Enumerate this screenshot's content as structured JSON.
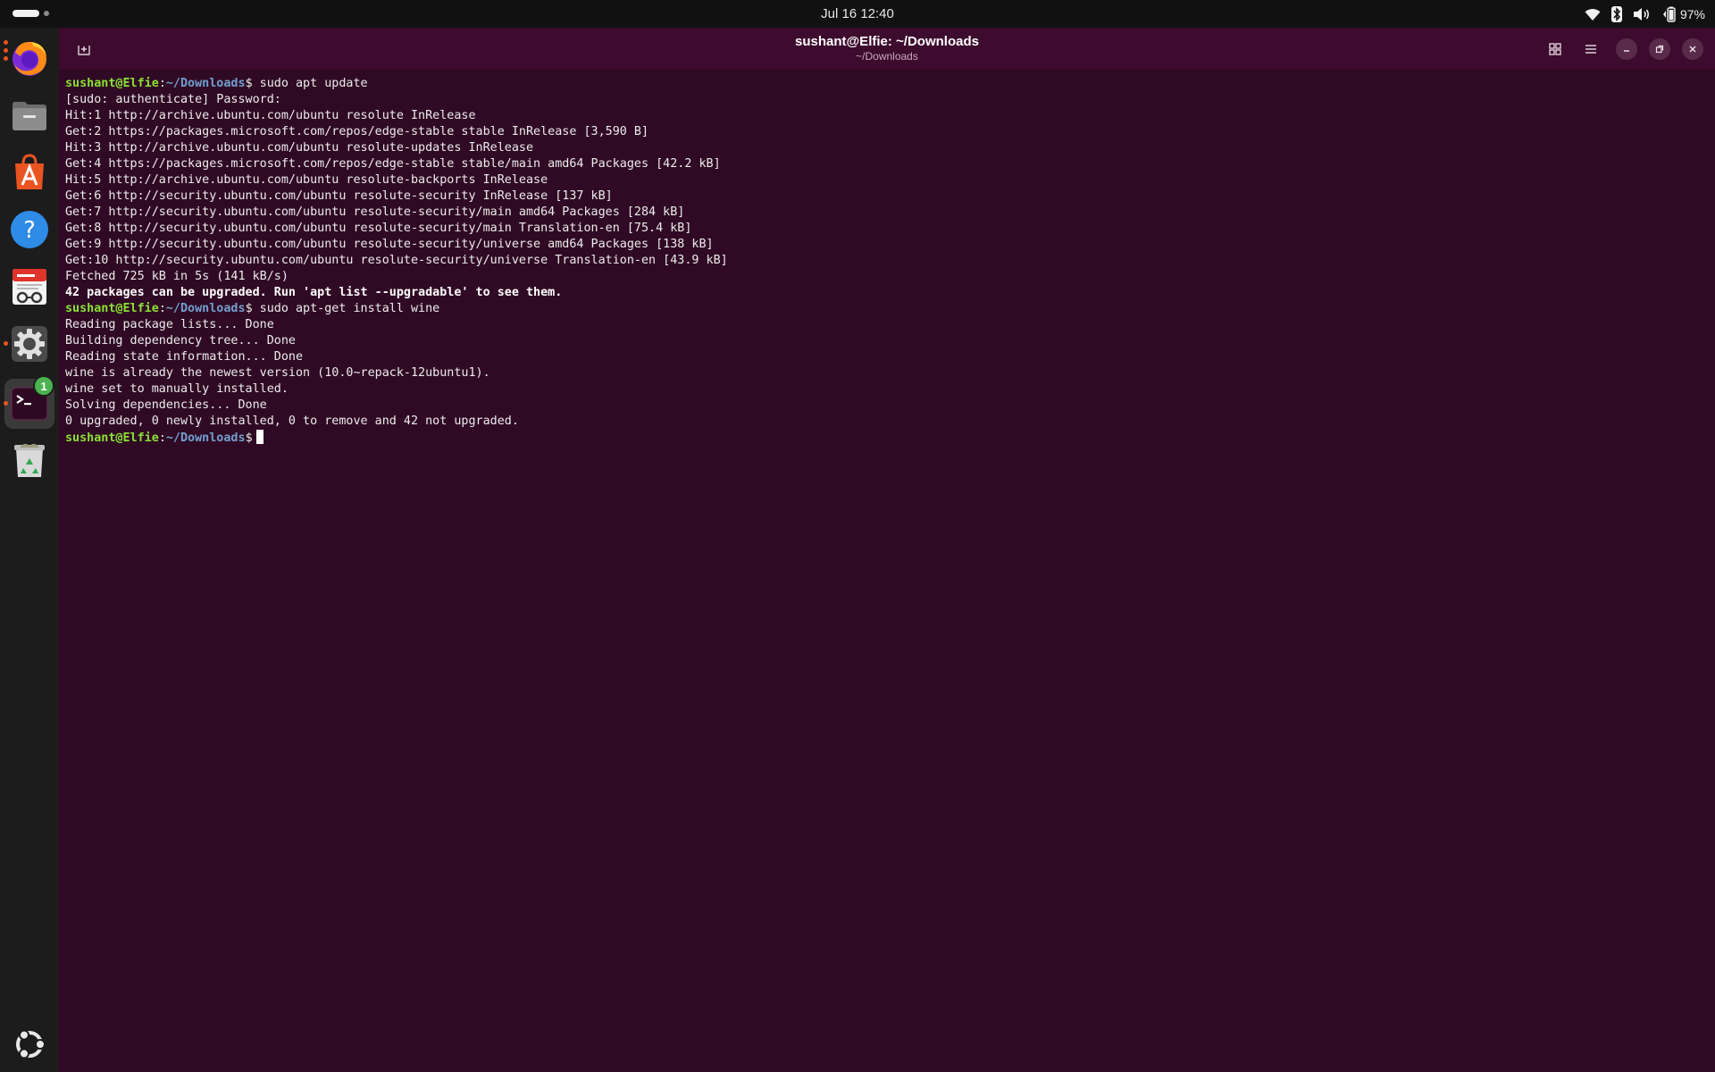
{
  "topbar": {
    "clock": "Jul 16  12:40",
    "battery": "97%"
  },
  "dock": {
    "apps": [
      {
        "name": "firefox",
        "icon": "firefox-icon"
      },
      {
        "name": "files",
        "icon": "files-icon"
      },
      {
        "name": "app-center",
        "icon": "app-center-icon"
      },
      {
        "name": "help",
        "icon": "help-icon"
      },
      {
        "name": "document-viewer",
        "icon": "document-viewer-icon"
      },
      {
        "name": "settings",
        "icon": "gear-icon"
      },
      {
        "name": "terminal",
        "icon": "terminal-icon",
        "badge": "1"
      },
      {
        "name": "trash",
        "icon": "trash-icon"
      }
    ],
    "show_apps_icon": "ubuntu-logo-icon"
  },
  "window": {
    "title": "sushant@Elfie: ~/Downloads",
    "subtitle": "~/Downloads"
  },
  "colors": {
    "terminal_bg": "#300a24",
    "prompt_user": "#8ae234",
    "prompt_path": "#729fcf",
    "accent": "#e95420"
  },
  "prompt": {
    "user": "sushant@Elfie",
    "sep": ":",
    "path": "~/Downloads",
    "symbol": "$"
  },
  "terminal_lines": [
    {
      "type": "prompt",
      "cmd": " sudo apt update"
    },
    {
      "type": "text",
      "text": "[sudo: authenticate] Password:"
    },
    {
      "type": "text",
      "text": "Hit:1 http://archive.ubuntu.com/ubuntu resolute InRelease"
    },
    {
      "type": "text",
      "text": "Get:2 https://packages.microsoft.com/repos/edge-stable stable InRelease [3,590 B]"
    },
    {
      "type": "text",
      "text": "Hit:3 http://archive.ubuntu.com/ubuntu resolute-updates InRelease"
    },
    {
      "type": "text",
      "text": "Get:4 https://packages.microsoft.com/repos/edge-stable stable/main amd64 Packages [42.2 kB]"
    },
    {
      "type": "text",
      "text": "Hit:5 http://archive.ubuntu.com/ubuntu resolute-backports InRelease"
    },
    {
      "type": "text",
      "text": "Get:6 http://security.ubuntu.com/ubuntu resolute-security InRelease [137 kB]"
    },
    {
      "type": "text",
      "text": "Get:7 http://security.ubuntu.com/ubuntu resolute-security/main amd64 Packages [284 kB]"
    },
    {
      "type": "text",
      "text": "Get:8 http://security.ubuntu.com/ubuntu resolute-security/main Translation-en [75.4 kB]"
    },
    {
      "type": "text",
      "text": "Get:9 http://security.ubuntu.com/ubuntu resolute-security/universe amd64 Packages [138 kB]"
    },
    {
      "type": "text",
      "text": "Get:10 http://security.ubuntu.com/ubuntu resolute-security/universe Translation-en [43.9 kB]"
    },
    {
      "type": "text",
      "text": "Fetched 725 kB in 5s (141 kB/s)"
    },
    {
      "type": "bold",
      "text": "42 packages can be upgraded. Run 'apt list --upgradable' to see them."
    },
    {
      "type": "prompt",
      "cmd": " sudo apt-get install wine"
    },
    {
      "type": "text",
      "text": "Reading package lists... Done"
    },
    {
      "type": "text",
      "text": "Building dependency tree... Done"
    },
    {
      "type": "text",
      "text": "Reading state information... Done"
    },
    {
      "type": "text",
      "text": "wine is already the newest version (10.0~repack-12ubuntu1)."
    },
    {
      "type": "text",
      "text": "wine set to manually installed."
    },
    {
      "type": "text",
      "text": "Solving dependencies... Done"
    },
    {
      "type": "text",
      "text": "0 upgraded, 0 newly installed, 0 to remove and 42 not upgraded."
    },
    {
      "type": "prompt",
      "cmd": "",
      "cursor": true
    }
  ]
}
